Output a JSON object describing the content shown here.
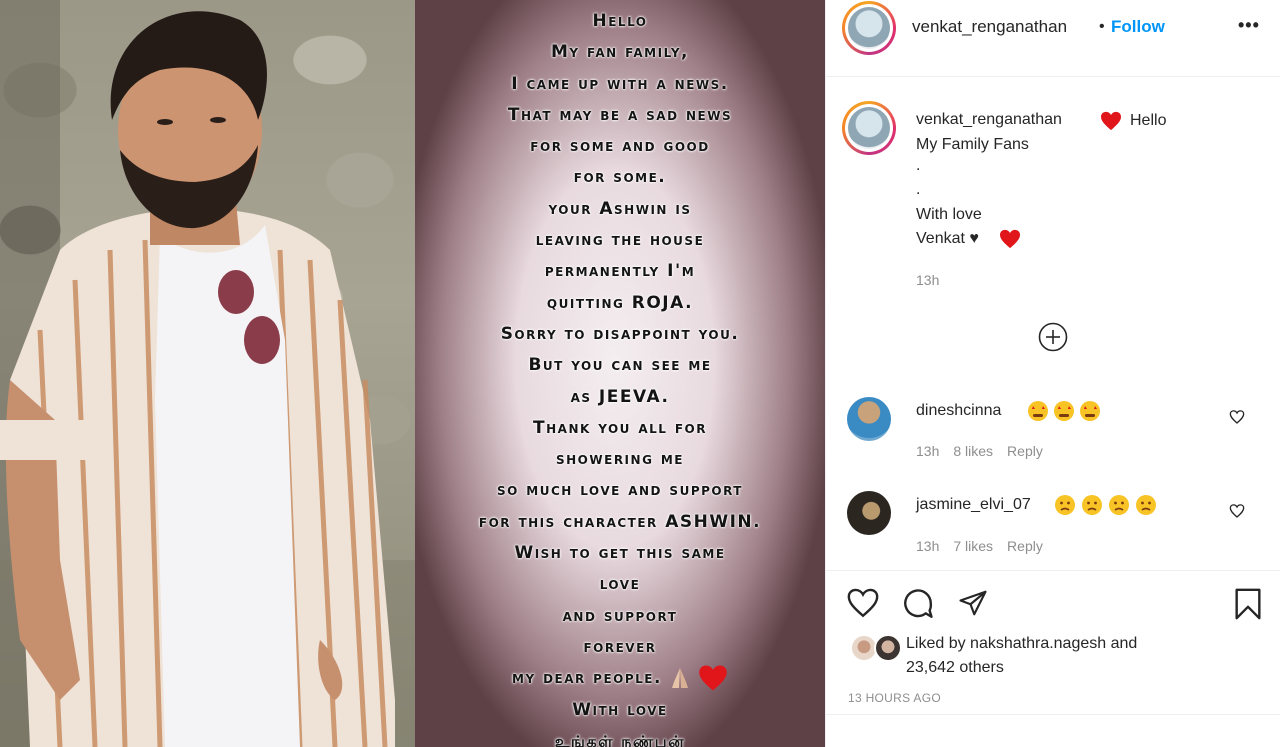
{
  "post": {
    "story_lines": [
      "Hello",
      "My fan family,",
      "I came up with a news.",
      "That may  be a sad news",
      "for some and good",
      "for some.",
      "your Ashwin is",
      "leaving the house",
      "permanently I'm",
      "quitting ROJA.",
      "Sorry to disappoint you.",
      "But you can see me",
      "as JEEVA.",
      "Thank you all for",
      "showering me",
      "so much love and support",
      "for this character ASHWIN.",
      "Wish to get this same",
      "love",
      "and support",
      "forever",
      "my dear people.",
      "With love",
      "உங்கள் நண்பன்"
    ]
  },
  "header": {
    "username": "venkat_renganathan",
    "separator": "•",
    "follow_label": "Follow",
    "more_label": "•••"
  },
  "caption": {
    "username": "venkat_renganathan",
    "line1": "Hello",
    "line2": "My Family Fans",
    "dot1": ".",
    "dot2": ".",
    "line3": "With love",
    "line4": "Venkat ♥",
    "time": "13h"
  },
  "comments": [
    {
      "username": "dineshcinna",
      "time": "13h",
      "likes": "8 likes",
      "reply": "Reply"
    },
    {
      "username": "jasmine_elvi_07",
      "time": "13h",
      "likes": "7 likes",
      "reply": "Reply"
    }
  ],
  "likes": {
    "prefix": "Liked by",
    "user": "nakshathra.nagesh",
    "and": "and",
    "others": "23,642 others"
  },
  "timestamp": "13 HOURS AGO",
  "colors": {
    "follow": "#0095f6",
    "heart_red": "#e0161b",
    "text": "#262626",
    "muted": "#8e8e8e"
  },
  "icons": [
    "more-icon",
    "heart-emoji-icon",
    "plus-circle-icon",
    "heart-outline-icon",
    "comment-icon",
    "share-icon",
    "bookmark-icon",
    "star-struck-emoji-icon",
    "sad-emoji-icon",
    "folded-hands-emoji-icon"
  ]
}
